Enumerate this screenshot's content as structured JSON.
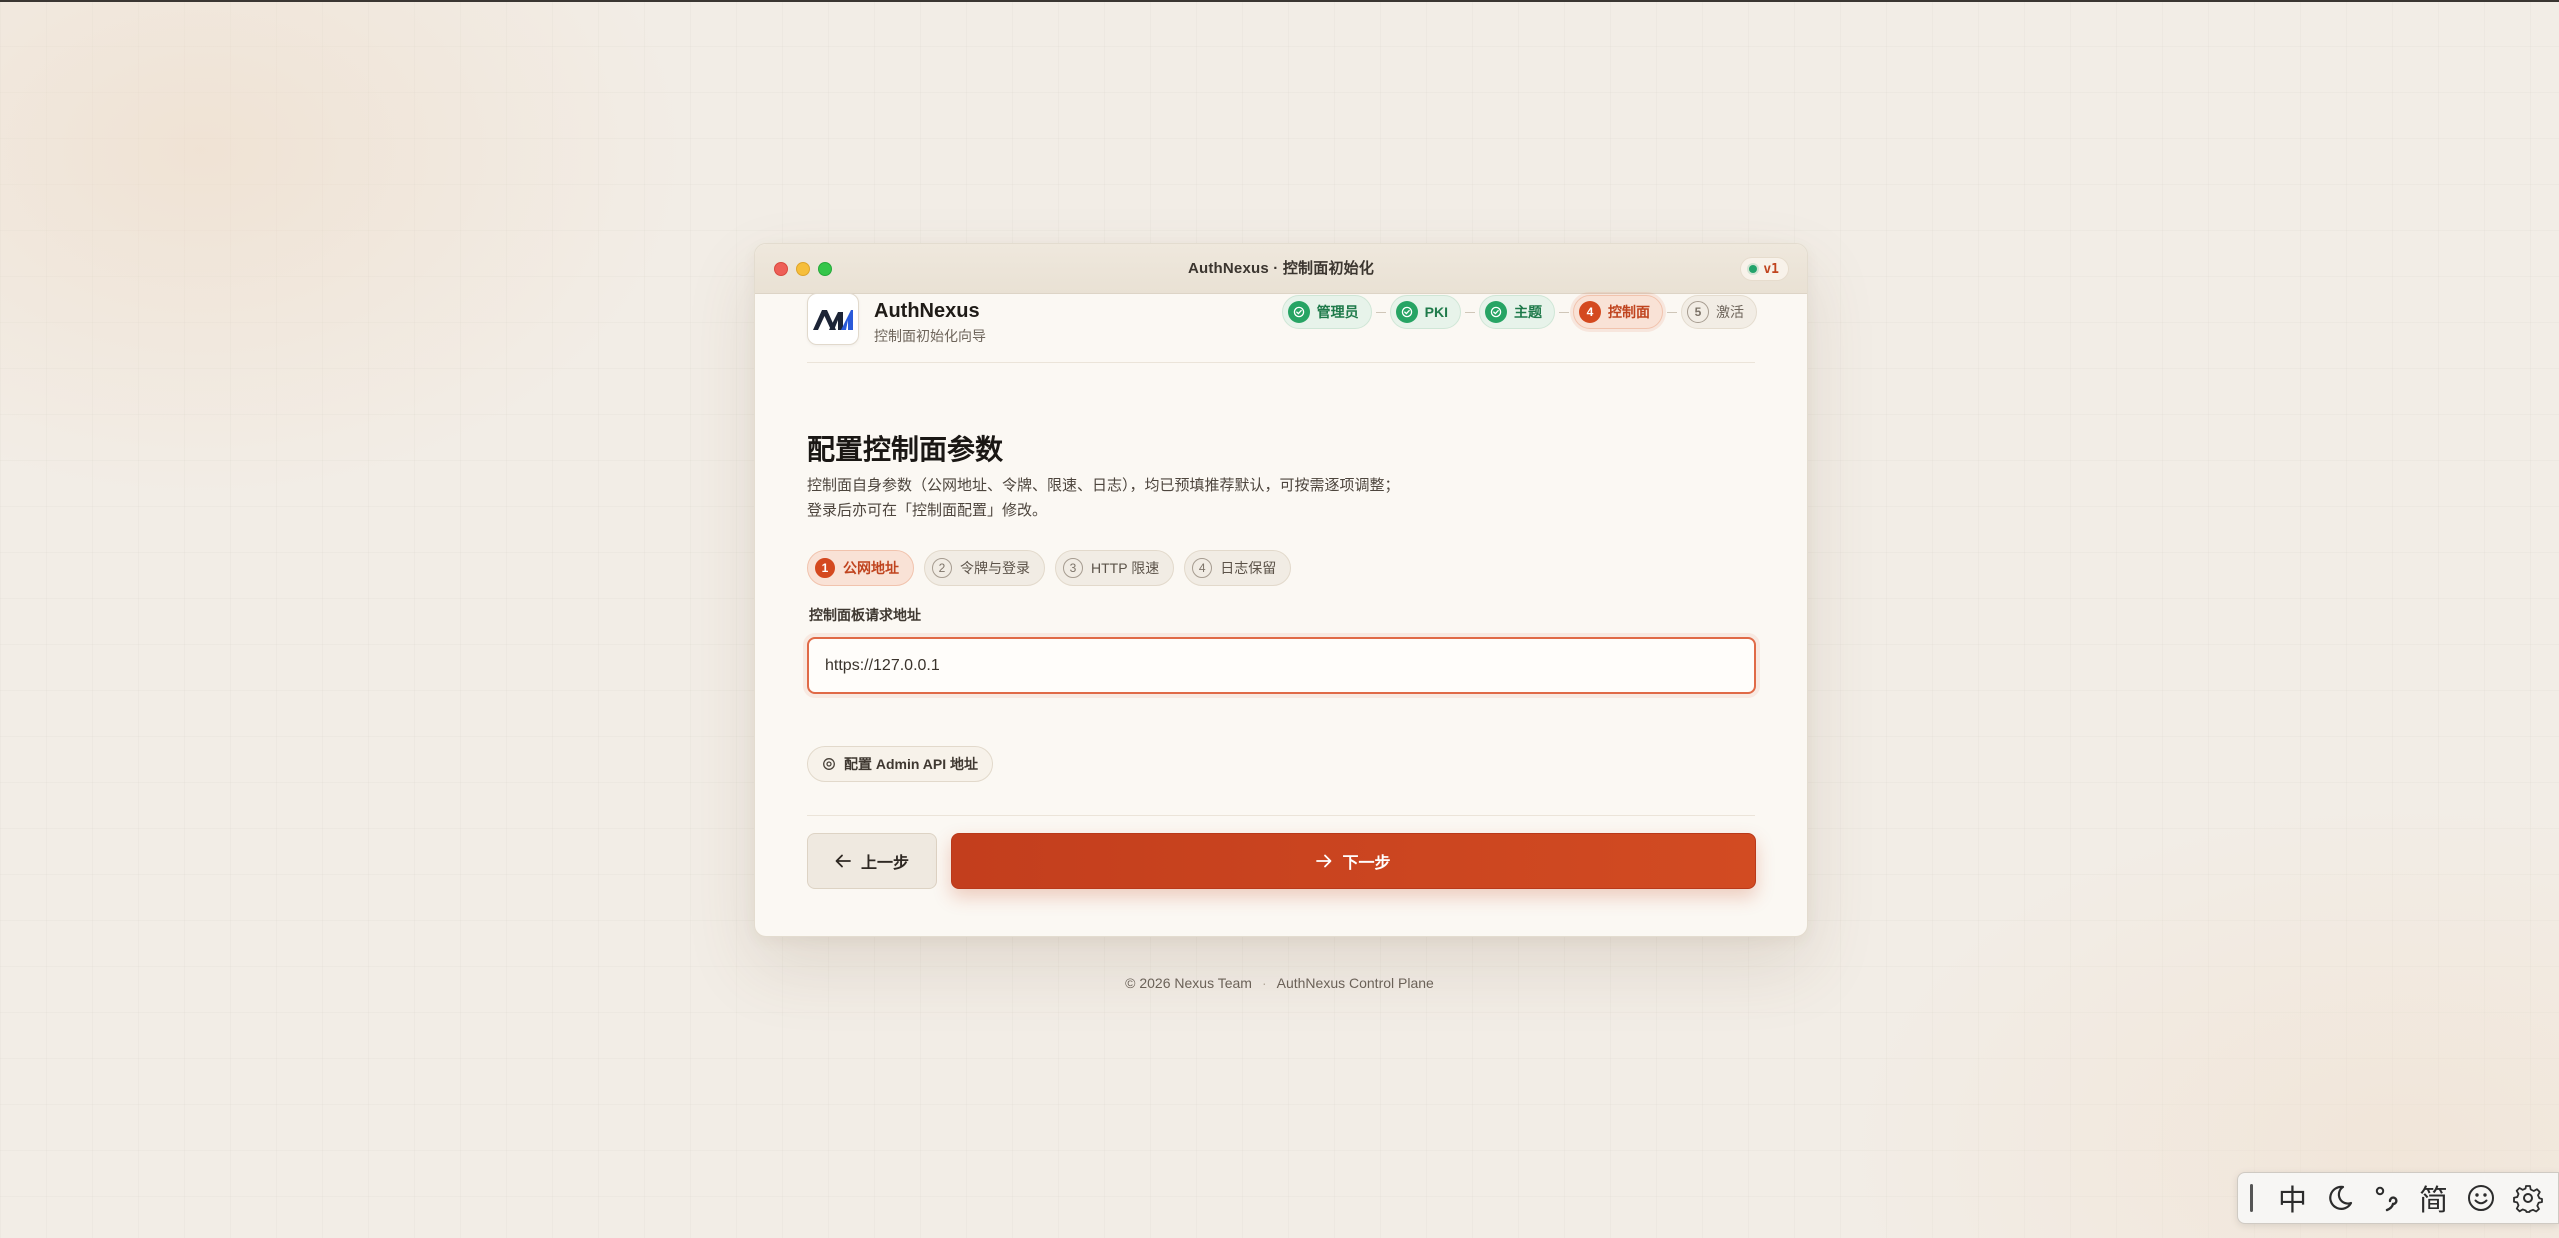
{
  "window": {
    "title": "AuthNexus · 控制面初始化",
    "version": "v1"
  },
  "brand": {
    "name": "AuthNexus",
    "subtitle": "控制面初始化向导"
  },
  "steps": [
    {
      "label": "管理员",
      "state": "done"
    },
    {
      "label": "PKI",
      "state": "done"
    },
    {
      "label": "主题",
      "state": "done"
    },
    {
      "label": "控制面",
      "number": "4",
      "state": "active"
    },
    {
      "label": "激活",
      "number": "5",
      "state": "todo"
    }
  ],
  "page": {
    "heading": "配置控制面参数",
    "description_line1": "控制面自身参数（公网地址、令牌、限速、日志），均已预填推荐默认，可按需逐项调整；",
    "description_line2": "登录后亦可在「控制面配置」修改。"
  },
  "subtabs": [
    {
      "number": "1",
      "label": "公网地址",
      "active": true
    },
    {
      "number": "2",
      "label": "令牌与登录",
      "active": false
    },
    {
      "number": "3",
      "label": "HTTP 限速",
      "active": false
    },
    {
      "number": "4",
      "label": "日志保留",
      "active": false
    }
  ],
  "form": {
    "label": "控制面板请求地址",
    "value": "https://127.0.0.1"
  },
  "admin_api_button": "配置 Admin API 地址",
  "nav": {
    "prev": "上一步",
    "next": "下一步"
  },
  "footer": {
    "copyright": "© 2026 Nexus Team",
    "product": "AuthNexus Control Plane"
  },
  "ime": {
    "items": [
      "中",
      "moon-icon",
      "punctuation-icon",
      "简",
      "smiley-icon",
      "gear-icon"
    ],
    "mode": "中",
    "script": "简"
  },
  "colors": {
    "accent": "#d4491f",
    "success": "#27a464",
    "background": "#f2ede6"
  }
}
